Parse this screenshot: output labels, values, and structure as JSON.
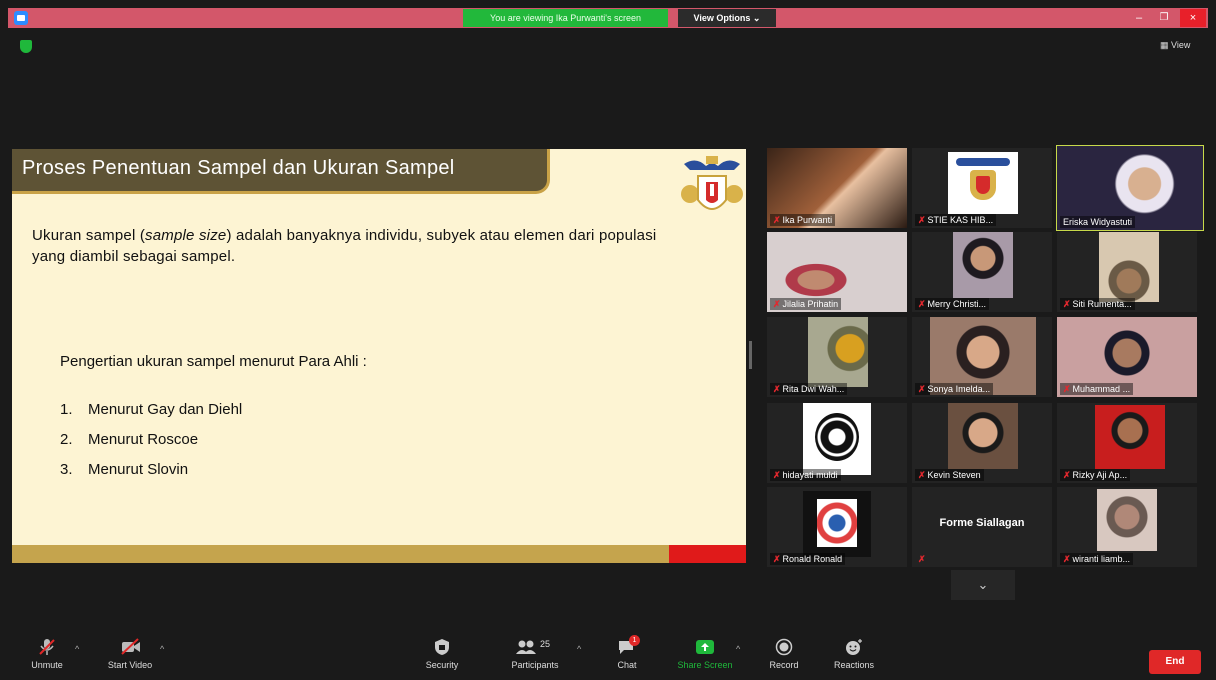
{
  "titlebar": {
    "viewing_banner": "You are viewing Ika Purwanti's screen",
    "view_options": "View Options ⌄",
    "minimize": "–",
    "maximize": "❐",
    "close": "×"
  },
  "top": {
    "view_label": "▦ View"
  },
  "slide": {
    "title": "Proses Penentuan Sampel dan Ukuran Sampel",
    "definition_before": "Ukuran sampel (",
    "definition_italic": "sample size",
    "definition_after": ") adalah banyaknya individu, subyek atau elemen dari populasi yang diambil sebagai sampel.",
    "subheading": "Pengertian ukuran sampel menurut Para Ahli :",
    "list": [
      {
        "num": "1.",
        "text": "Menurut Gay dan Diehl"
      },
      {
        "num": "2.",
        "text": "Menurut Roscoe"
      },
      {
        "num": "3.",
        "text": "Menurut Slovin"
      }
    ]
  },
  "participants": [
    {
      "name": "Ika Purwanti",
      "color": "#5a3a22"
    },
    {
      "name": "STIE KAS HIB...",
      "color": "#2a2a2a"
    },
    {
      "name": "Eriska Widyastuti",
      "color": "#3a3550"
    },
    {
      "name": "Jilalia Prihatin",
      "color": "#8a6f66"
    },
    {
      "name": "Merry Christi...",
      "color": "#3b3240"
    },
    {
      "name": "Siti Rumenta...",
      "color": "#6a5a46"
    },
    {
      "name": "Rita Dwi Wah...",
      "color": "#5b5a3c"
    },
    {
      "name": "Sonya Imelda...",
      "color": "#6a4a3a"
    },
    {
      "name": "Muhammad ...",
      "color": "#7a5a50"
    },
    {
      "name": "hidayati muldi",
      "color": "#222222"
    },
    {
      "name": "Kevin Steven",
      "color": "#4a3a30"
    },
    {
      "name": "Rizky Aji Ap...",
      "color": "#8a1a1a"
    },
    {
      "name": "Ronald Ronald",
      "color": "#2a2a2a"
    },
    {
      "name": "Forme Siallagan",
      "color": "#232323"
    },
    {
      "name": "wiranti liamb...",
      "color": "#3a3230"
    }
  ],
  "scroll_down": "⌄",
  "toolbar": {
    "unmute": "Unmute",
    "start_video": "Start Video",
    "security": "Security",
    "participants": "Participants",
    "participants_count": "25",
    "chat": "Chat",
    "chat_badge": "1",
    "share_screen": "Share Screen",
    "record": "Record",
    "reactions": "Reactions",
    "end": "End"
  },
  "colors": {
    "titlebar": "#d3576a",
    "viewing_banner": "#22b83b",
    "slide_bg": "#fdf4d3",
    "slide_header": "#5e5335",
    "gold": "#c5a44d",
    "end_button": "#e02828",
    "share_green": "#1fb83b"
  }
}
